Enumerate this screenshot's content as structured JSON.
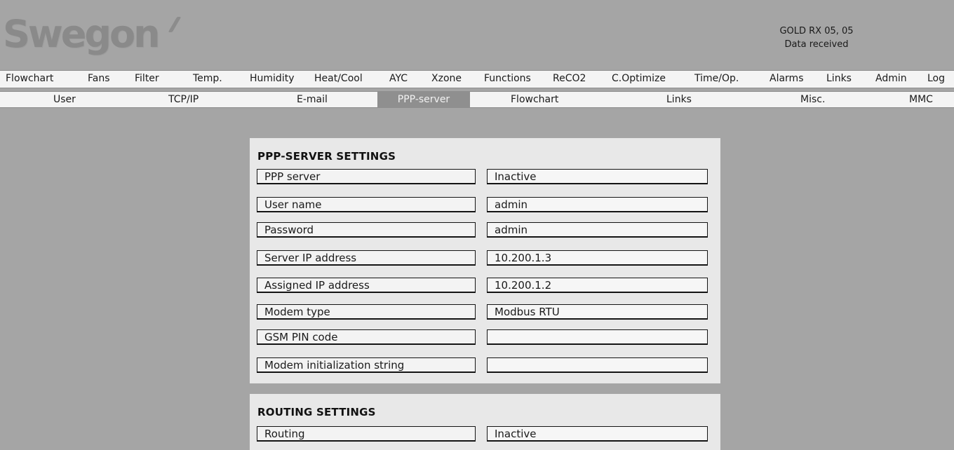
{
  "brand": {
    "logo_text": "Swegon"
  },
  "device": {
    "name": "GOLD RX 05, 05",
    "status": "Data received"
  },
  "nav_main": {
    "items": [
      {
        "label": "Flowchart"
      },
      {
        "label": "Fans"
      },
      {
        "label": "Filter"
      },
      {
        "label": "Temp."
      },
      {
        "label": "Humidity"
      },
      {
        "label": "Heat/Cool"
      },
      {
        "label": "AYC"
      },
      {
        "label": "Xzone"
      },
      {
        "label": "Functions"
      },
      {
        "label": "ReCO2"
      },
      {
        "label": "C.Optimize"
      },
      {
        "label": "Time/Op."
      },
      {
        "label": "Alarms"
      },
      {
        "label": "Links"
      },
      {
        "label": "Admin"
      },
      {
        "label": "Log"
      }
    ]
  },
  "nav_sub": {
    "active": "PPP-server",
    "items": [
      {
        "label": "User"
      },
      {
        "label": "TCP/IP"
      },
      {
        "label": "E-mail"
      },
      {
        "label": "PPP-server"
      },
      {
        "label": "Flowchart"
      },
      {
        "label": "Links"
      },
      {
        "label": "Misc."
      },
      {
        "label": "MMC"
      }
    ]
  },
  "ppp_settings": {
    "title": "PPP-SERVER SETTINGS",
    "rows": [
      {
        "label": "PPP server",
        "value": "Inactive"
      },
      {
        "label": "User name",
        "value": "admin"
      },
      {
        "label": "Password",
        "value": "admin"
      },
      {
        "label": "Server IP address",
        "value": "10.200.1.3"
      },
      {
        "label": "Assigned IP address",
        "value": "10.200.1.2"
      },
      {
        "label": "Modem type",
        "value": "Modbus RTU"
      },
      {
        "label": "GSM PIN code",
        "value": ""
      },
      {
        "label": "Modem initialization string",
        "value": ""
      }
    ]
  },
  "routing_settings": {
    "title": "ROUTING SETTINGS",
    "rows": [
      {
        "label": "Routing",
        "value": "Inactive"
      }
    ]
  }
}
